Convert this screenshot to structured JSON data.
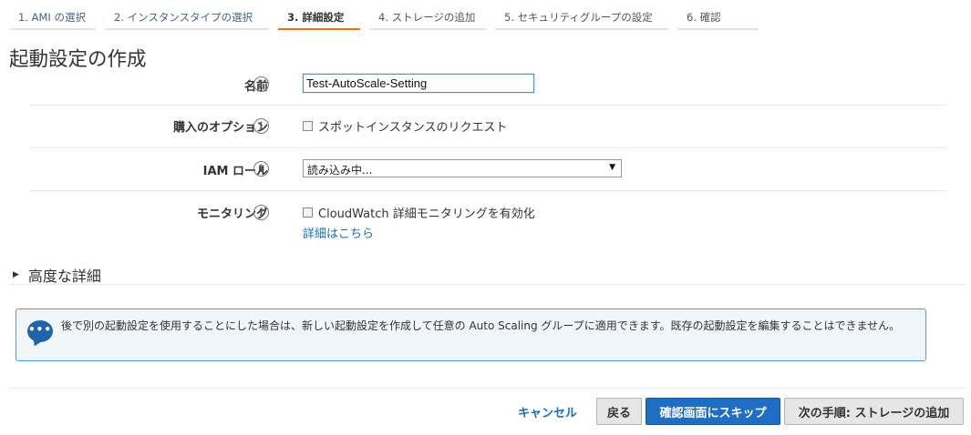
{
  "wizard": {
    "steps": [
      {
        "label": "1. AMI の選択"
      },
      {
        "label": "2. インスタンスタイプの選択"
      },
      {
        "label": "3. 詳細設定"
      },
      {
        "label": "4. ストレージの追加"
      },
      {
        "label": "5. セキュリティグループの設定"
      },
      {
        "label": "6. 確認"
      }
    ]
  },
  "page": {
    "title": "起動設定の作成"
  },
  "form": {
    "name": {
      "label": "名前",
      "value": "Test-AutoScale-Setting"
    },
    "purchase": {
      "label": "購入のオプション",
      "checkbox_label": "スポットインスタンスのリクエスト"
    },
    "iam_role": {
      "label": "IAM ロール",
      "selected": "読み込み中..."
    },
    "monitoring": {
      "label": "モニタリング",
      "checkbox_label": "CloudWatch 詳細モニタリングを有効化",
      "link": "詳細はこちら"
    },
    "info_icon": "i"
  },
  "advanced": {
    "label": "高度な詳細"
  },
  "notice": {
    "text": "後で別の起動設定を使用することにした場合は、新しい起動設定を作成して任意の Auto Scaling グループに適用できます。既存の起動設定を編集することはできません。"
  },
  "buttons": {
    "cancel": "キャンセル",
    "back": "戻る",
    "skip_to_review": "確認画面にスキップ",
    "next": "次の手順: ストレージの追加"
  },
  "colors": {
    "accent": "#ec7211",
    "primary_button": "#1f6ec4",
    "link": "#1a6fb5"
  }
}
